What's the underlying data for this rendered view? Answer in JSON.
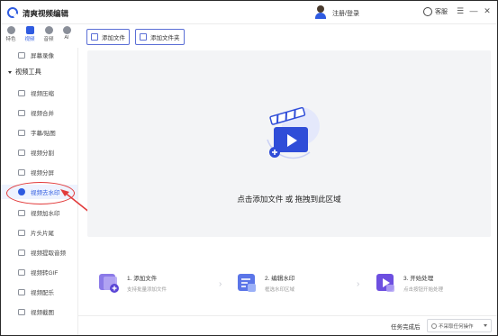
{
  "app": {
    "title": "清爽视频编辑"
  },
  "header": {
    "login": "注册/登录",
    "support": "客服",
    "menu_icon": "menu-icon",
    "minimize_icon": "minimize-icon",
    "close_icon": "close-icon"
  },
  "topnav": [
    {
      "label": "特色",
      "icon": "feature-icon",
      "active": false
    },
    {
      "label": "视频",
      "icon": "video-icon",
      "active": true
    },
    {
      "label": "音频",
      "icon": "audio-icon",
      "active": false
    },
    {
      "label": "AI",
      "icon": "ai-icon",
      "active": false
    }
  ],
  "sidebar": {
    "top_item": "屏幕录像",
    "group_title": "视频工具",
    "items": [
      {
        "label": "视频压缩",
        "icon": "compress-icon"
      },
      {
        "label": "视频合并",
        "icon": "merge-icon"
      },
      {
        "label": "字幕/贴图",
        "icon": "subtitle-icon"
      },
      {
        "label": "视频分割",
        "icon": "split-icon"
      },
      {
        "label": "视频分屏",
        "icon": "split-screen-icon"
      },
      {
        "label": "视频去水印",
        "icon": "remove-watermark-icon",
        "active": true
      },
      {
        "label": "视频加水印",
        "icon": "add-watermark-icon"
      },
      {
        "label": "片头片尾",
        "icon": "intro-outro-icon"
      },
      {
        "label": "视频提取音频",
        "icon": "extract-audio-icon"
      },
      {
        "label": "视频转GIF",
        "icon": "gif-icon"
      },
      {
        "label": "视频配乐",
        "icon": "music-icon"
      },
      {
        "label": "视频截图",
        "icon": "screenshot-icon"
      }
    ]
  },
  "toolbar": {
    "add_file": "添加文件",
    "add_folder": "添加文件夹"
  },
  "dropzone": {
    "text": "点击添加文件 或 拖拽到此区域"
  },
  "steps": [
    {
      "title": "1. 添加文件",
      "desc": "支持批量添加文件"
    },
    {
      "title": "2. 编辑水印",
      "desc": "框选水印区域"
    },
    {
      "title": "3. 开始处理",
      "desc": "点击按钮开始处理"
    }
  ],
  "status": {
    "label": "任务完成后",
    "select_value": "不采取任何操作"
  },
  "colors": {
    "accent": "#2f5be0",
    "annotation": "#e23b3b"
  }
}
